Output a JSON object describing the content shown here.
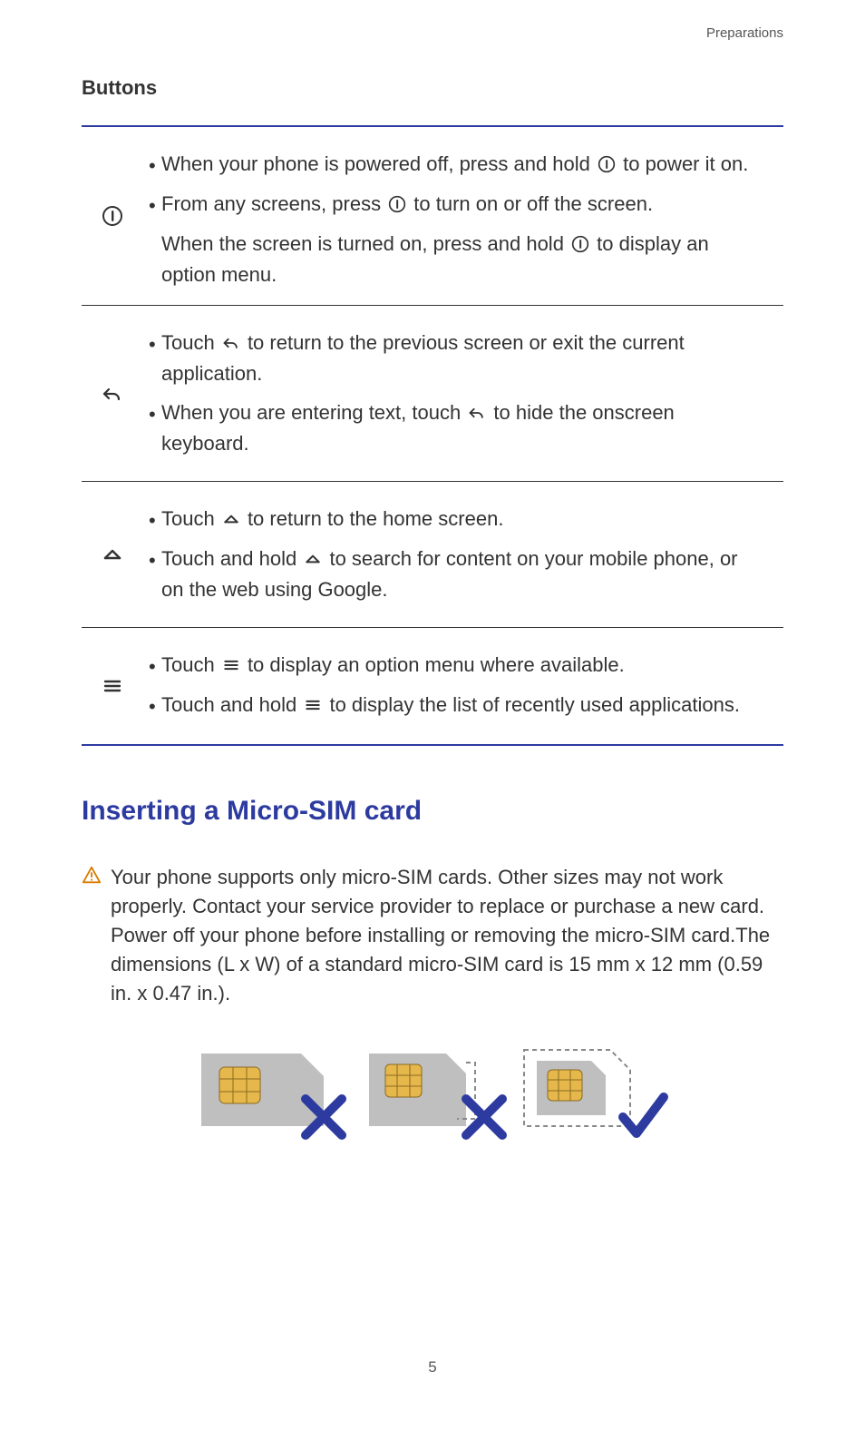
{
  "running_head": "Preparations",
  "subhead": "Buttons",
  "buttons": [
    {
      "icon": "power-icon",
      "bullets": [
        {
          "pre": "When your phone is powered off, press and hold ",
          "icon": "power-icon",
          "post": " to power it on."
        },
        {
          "pre": "From any screens, press ",
          "icon": "power-icon",
          "post": " to turn on or off the screen."
        }
      ],
      "continuation": {
        "pre": "When the screen is turned on, press and hold ",
        "icon": "power-icon",
        "post": " to display an option menu."
      }
    },
    {
      "icon": "back-icon",
      "bullets": [
        {
          "pre": "Touch ",
          "icon": "back-icon",
          "post": " to return to the previous screen or exit the current application."
        },
        {
          "pre": "When you are entering text, touch ",
          "icon": "back-icon",
          "post": " to hide the onscreen keyboard."
        }
      ]
    },
    {
      "icon": "home-icon",
      "bullets": [
        {
          "pre": "Touch ",
          "icon": "home-icon",
          "post": " to return to the home screen."
        },
        {
          "pre": "Touch and hold ",
          "icon": "home-icon",
          "post": " to search for content on your mobile phone, or on the web using Google."
        }
      ]
    },
    {
      "icon": "menu-icon",
      "bullets": [
        {
          "pre": "Touch ",
          "icon": "menu-icon",
          "post": " to display an option menu where available."
        },
        {
          "pre": "Touch and hold ",
          "icon": "menu-icon",
          "post": " to display the list of recently used applications."
        }
      ]
    }
  ],
  "section_title": "Inserting a Micro-SIM card",
  "warning_text": "Your phone supports only micro-SIM cards. Other sizes may not work properly. Contact your service provider to replace or purchase a new card. Power off your phone before installing or removing the micro-SIM card.The dimensions (L x W) of a standard micro-SIM card is 15 mm x 12 mm (0.59 in. x 0.47 in.).",
  "sim_figure": {
    "items": [
      {
        "type": "mini-sim",
        "status": "wrong"
      },
      {
        "type": "nano-sim-in-mini-adapter",
        "status": "wrong"
      },
      {
        "type": "micro-sim",
        "status": "correct"
      }
    ]
  },
  "page_number": "5",
  "bullet_char": "•"
}
